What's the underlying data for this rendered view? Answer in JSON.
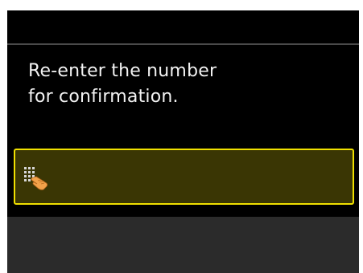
{
  "message": {
    "line1": "Re-enter the number",
    "line2": "for confirmation."
  },
  "number_field": {
    "value": "",
    "icon": "keypad-touch-icon"
  },
  "colors": {
    "screen_background": "#000000",
    "field_border": "#f0e000",
    "field_background": "#3a3604",
    "bottom_bar": "#2b2b2b",
    "text": "#f2f2f2"
  }
}
